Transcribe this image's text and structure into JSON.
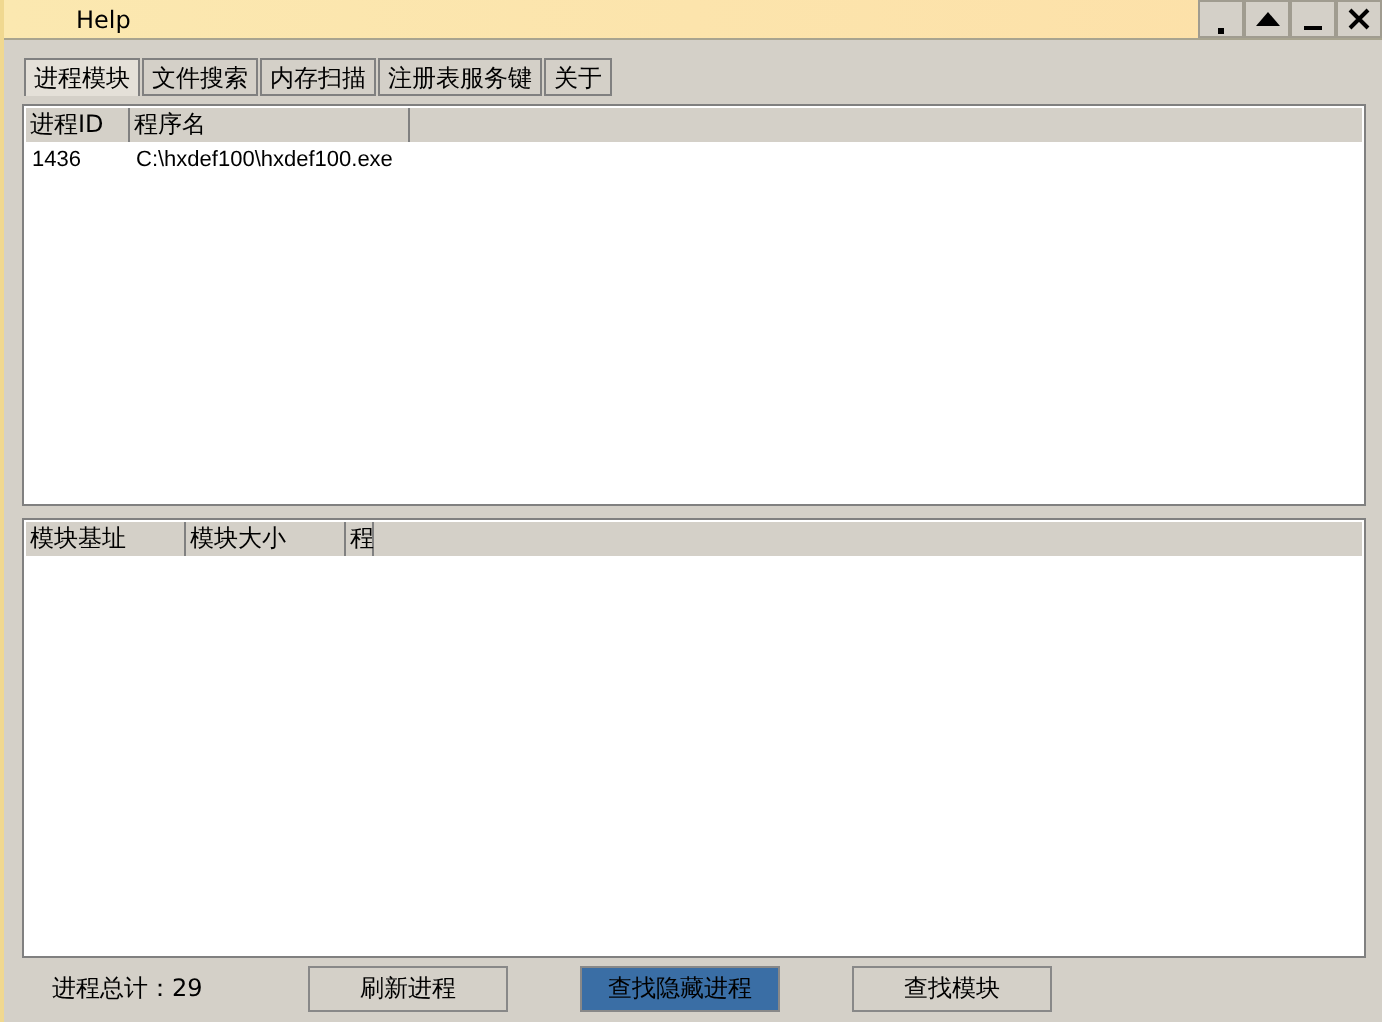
{
  "window": {
    "title": "Help"
  },
  "tabs": [
    {
      "label": "进程模块",
      "selected": true
    },
    {
      "label": "文件搜索",
      "selected": false
    },
    {
      "label": "内存扫描",
      "selected": false
    },
    {
      "label": "注册表服务键",
      "selected": false
    },
    {
      "label": "关于",
      "selected": false
    }
  ],
  "process_table": {
    "columns": [
      "进程ID",
      "程序名"
    ],
    "rows": [
      [
        "1436",
        "C:\\hxdef100\\hxdef100.exe"
      ]
    ]
  },
  "module_table": {
    "columns": [
      "模块基址",
      "模块大小",
      "程"
    ]
  },
  "status": {
    "process_total": "进程总计：29"
  },
  "buttons": [
    {
      "label": "刷新进程",
      "selected": false
    },
    {
      "label": "查找隐藏进程",
      "selected": true
    },
    {
      "label": "查找模块",
      "selected": false
    }
  ]
}
